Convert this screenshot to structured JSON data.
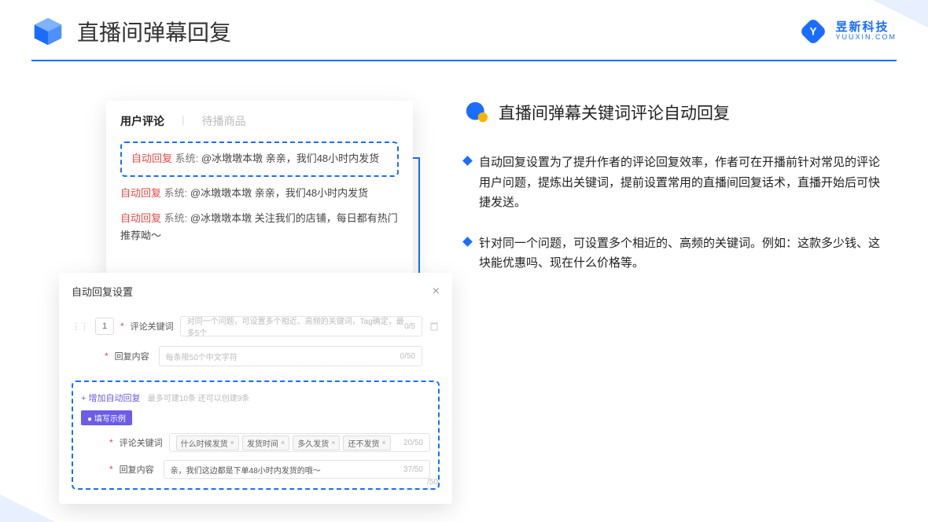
{
  "header": {
    "title": "直播间弹幕回复",
    "brand_cn": "昱新科技",
    "brand_en": "YUUXIN.COM"
  },
  "comments": {
    "tab_active": "用户评论",
    "tab_inactive": "待播商品",
    "auto_label": "自动回复",
    "sys_label": "系统:",
    "highlight_msg": "@冰墩墩本墩 亲亲，我们48小时内发货",
    "msg2": "@冰墩墩本墩 亲亲，我们48小时内发货",
    "msg3": "@冰墩墩本墩 关注我们的店铺，每日都有热门推荐呦～"
  },
  "settings": {
    "title": "自动回复设置",
    "order": "1",
    "kw_label": "评论关键词",
    "kw_placeholder": "对同一个问题，可设置多个相近、高频的关键词，Tag确定，最多5个",
    "kw_count": "0/5",
    "content_label": "回复内容",
    "content_placeholder": "每条限50个中文字符",
    "content_count": "0/50",
    "add_link": "+ 增加自动回复",
    "add_hint": "最多可建10条 还可以创建9条",
    "example_tag": "● 填写示例",
    "ex_kw_label": "评论关键词",
    "chips": [
      "什么时候发货",
      "发货时间",
      "多久发货",
      "还不发货"
    ],
    "chip_count": "20/50",
    "ex_content_label": "回复内容",
    "ex_content": "亲，我们这边都是下单48小时内发货的哦～",
    "ex_content_count": "37/50",
    "outside_count": "/50"
  },
  "right": {
    "section_title": "直播间弹幕关键词评论自动回复",
    "bullet1": "自动回复设置为了提升作者的评论回复效率，作者可在开播前针对常见的评论用户问题，提炼出关键词，提前设置常用的直播间回复话术，直播开始后可快捷发送。",
    "bullet2": "针对同一个问题，可设置多个相近的、高频的关键词。例如：这款多少钱、这块能优惠吗、现在什么价格等。"
  }
}
